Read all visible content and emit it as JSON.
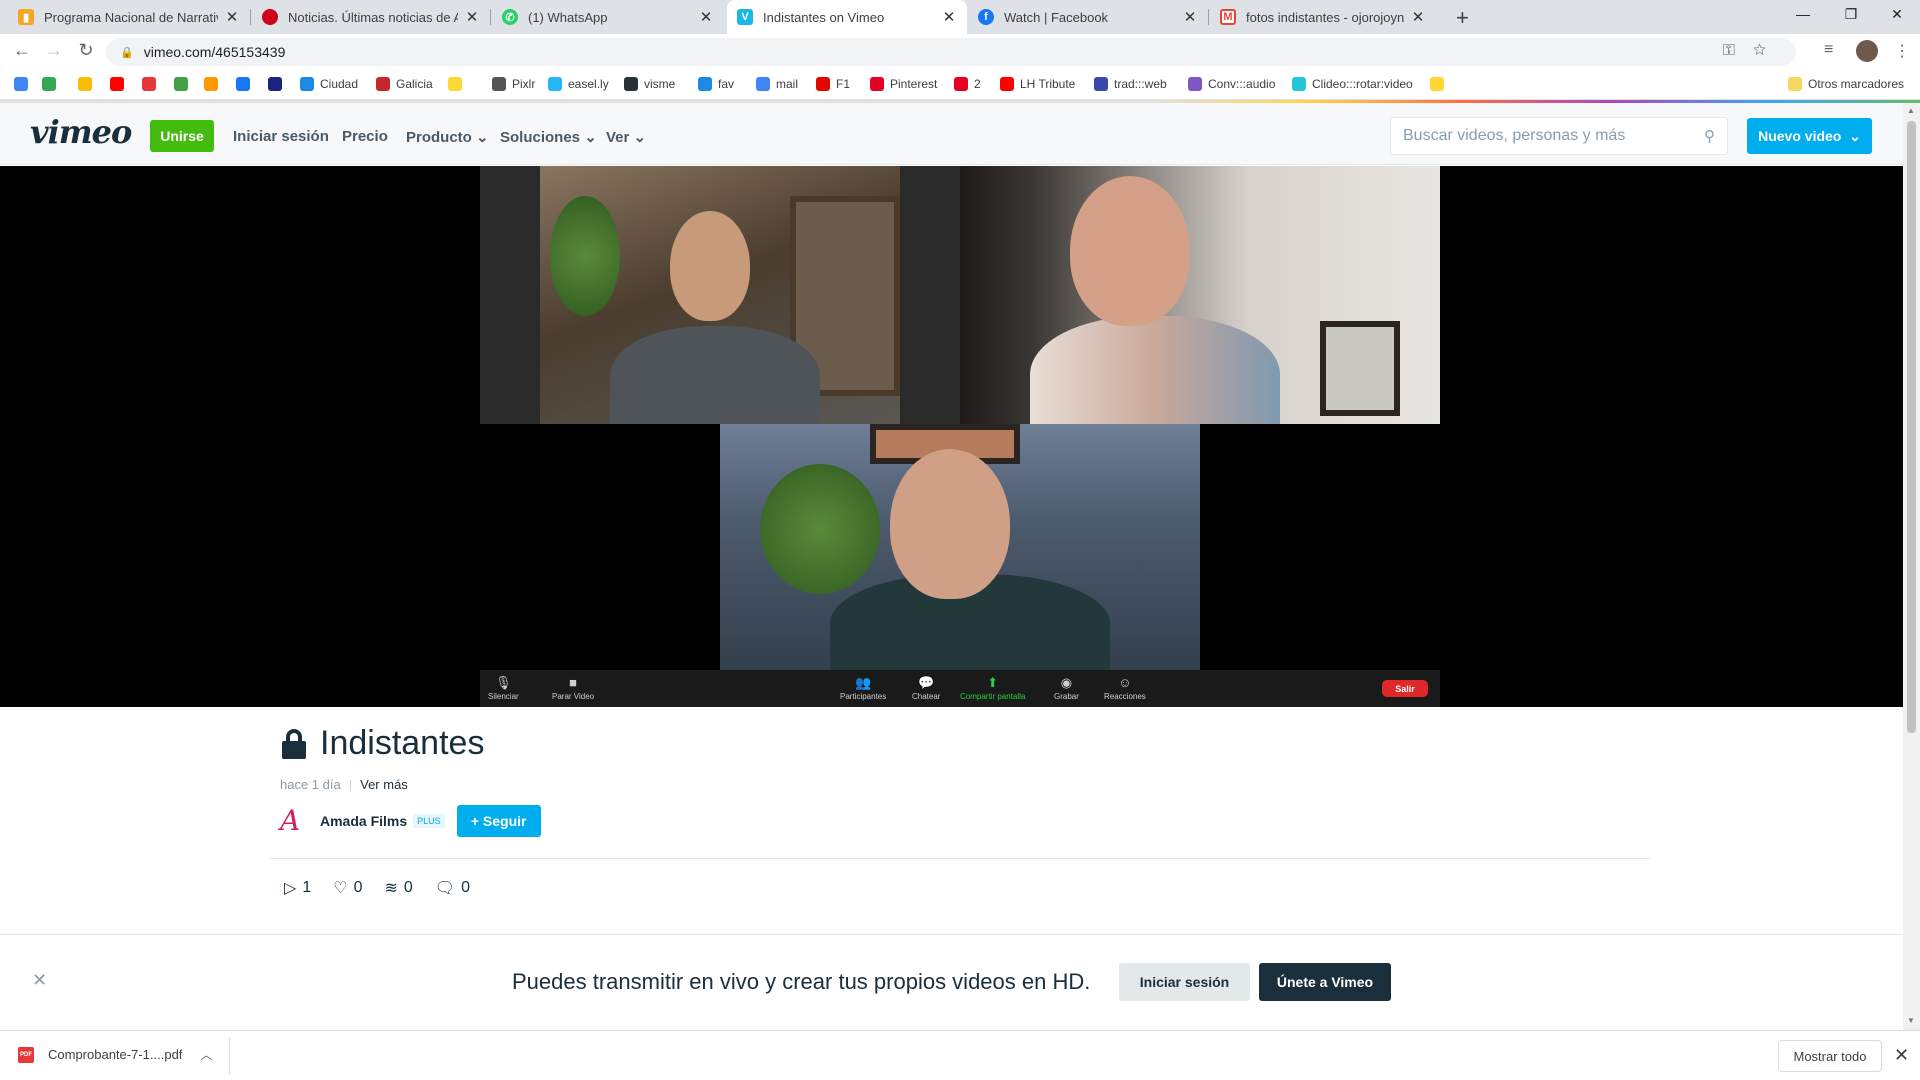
{
  "browser": {
    "tabs": [
      {
        "title": "Programa Nacional de Narrativas",
        "favicon": "bars-icon",
        "color": "#f5a623"
      },
      {
        "title": "Noticias. Últimas noticias de Argentina",
        "favicon": "news-icon",
        "color": "#d0021b"
      },
      {
        "title": "(1) WhatsApp",
        "favicon": "whatsapp-icon",
        "color": "#25d366"
      },
      {
        "title": "Indistantes on Vimeo",
        "favicon": "vimeo-icon",
        "color": "#1ab7ea"
      },
      {
        "title": "Watch | Facebook",
        "favicon": "facebook-icon",
        "color": "#1877f2"
      },
      {
        "title": "fotos indistantes - ojorojoynegro",
        "favicon": "gmail-icon",
        "color": "#ea4335"
      }
    ],
    "url": "vimeo.com/465153439",
    "bookmarks": [
      {
        "label": "",
        "color": "#4285f4"
      },
      {
        "label": "",
        "color": "#34a853"
      },
      {
        "label": "",
        "color": "#fbbc05"
      },
      {
        "label": "",
        "color": "#ff0000"
      },
      {
        "label": "",
        "color": "#e53935"
      },
      {
        "label": "",
        "color": "#43a047"
      },
      {
        "label": "",
        "color": "#ff9800"
      },
      {
        "label": "",
        "color": "#1877f2"
      },
      {
        "label": "",
        "color": "#1a237e"
      },
      {
        "label": "Ciudad",
        "color": "#1e88e5"
      },
      {
        "label": "Galicia",
        "color": "#c62828"
      },
      {
        "label": "",
        "color": "#fdd835"
      },
      {
        "label": "Pixlr",
        "color": "#555555"
      },
      {
        "label": "easel.ly",
        "color": "#29b6f6"
      },
      {
        "label": "visme",
        "color": "#263238"
      },
      {
        "label": "fav",
        "color": "#1e88e5"
      },
      {
        "label": "mail",
        "color": "#4285f4"
      },
      {
        "label": "F1",
        "color": "#e10600"
      },
      {
        "label": "Pinterest",
        "color": "#e60023"
      },
      {
        "label": "2",
        "color": "#e60023"
      },
      {
        "label": "LH Tribute",
        "color": "#ff0000"
      },
      {
        "label": "trad:::web",
        "color": "#3949ab"
      },
      {
        "label": "Conv:::audio",
        "color": "#7e57c2"
      },
      {
        "label": "Clideo:::rotar:video",
        "color": "#26c6da"
      },
      {
        "label": "",
        "color": "#fdd835"
      }
    ],
    "other_bookmarks": "Otros marcadores"
  },
  "vimeo": {
    "logo": "vimeo",
    "join": "Unirse",
    "nav": [
      "Iniciar sesión",
      "Precio",
      "Producto",
      "Soluciones",
      "Ver"
    ],
    "search_placeholder": "Buscar videos, personas y más",
    "new_video": "Nuevo video"
  },
  "zoom_controls": {
    "mute": "Silenciar",
    "stop_video": "Parar Video",
    "participants": "Participantes",
    "chat": "Chatear",
    "share": "Compartir pantalla",
    "record": "Grabar",
    "reactions": "Reacciones",
    "leave": "Salir"
  },
  "video": {
    "title": "Indistantes",
    "posted": "hace 1 día",
    "see_more": "Ver más",
    "owner": "Amada Films",
    "owner_badge": "PLUS",
    "follow": "+ Seguir",
    "stats": {
      "plays": "1",
      "likes": "0",
      "collections": "0",
      "comments": "0"
    }
  },
  "banner": {
    "text": "Puedes transmitir en vivo y crear tus propios videos en HD.",
    "login": "Iniciar sesión",
    "join": "Únete a Vimeo"
  },
  "downloads": {
    "file": "Comprobante-7-1....pdf",
    "show_all": "Mostrar todo"
  }
}
